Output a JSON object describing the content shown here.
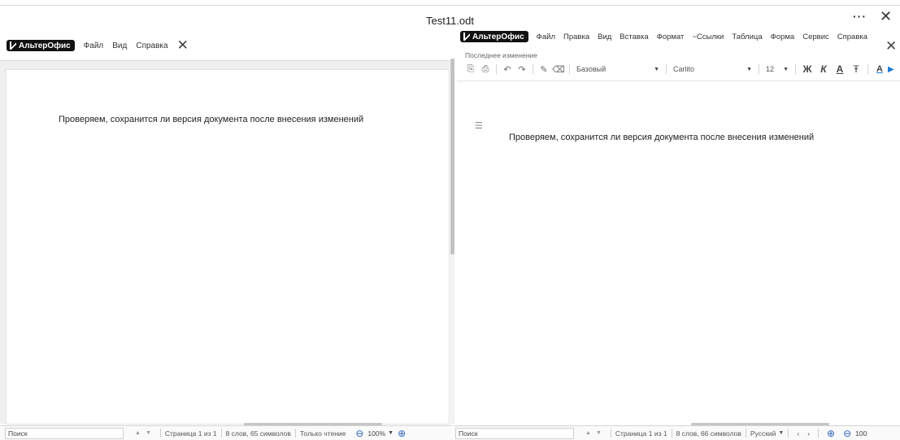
{
  "window": {
    "title": "Test11.odt",
    "more_label": "···",
    "close_label": "✕"
  },
  "left_pane": {
    "logo": "АльтерОфис",
    "menu": [
      "Файл",
      "Вид",
      "Справка"
    ],
    "close_label": "✕",
    "document_text": "Проверяем, сохранится ли версия документа после внесения изменений",
    "status": {
      "search_placeholder": "Поиск",
      "page": "Страница 1 из 1",
      "words": "8 слов, 65 символов",
      "mode": "Только чтение",
      "zoom": "100%"
    }
  },
  "right_pane": {
    "logo": "АльтерОфис",
    "menu": [
      "Файл",
      "Правка",
      "Вид",
      "Вставка",
      "Формат",
      "~Ссылки",
      "Таблица",
      "Форма",
      "Сервис",
      "Справка"
    ],
    "close_label": "✕",
    "last_change": "Последнее изменение",
    "toolbar": {
      "style": "Базовый",
      "font": "Carlito",
      "size": "12",
      "bold": "Ж",
      "italic": "К",
      "underline": "А",
      "strike": "Ŧ",
      "font_color": "А"
    },
    "document_text": "Проверяем, сохранится ли версия документа после внесения изменений",
    "status": {
      "search_placeholder": "Поиск",
      "page": "Страница 1 из 1",
      "words": "8 слов, 66 символов",
      "language": "Русский",
      "zoom": "100"
    }
  },
  "colors": {
    "accent": "#2b5fb8",
    "logo_bg": "#111111",
    "font_color_marker": "#1f7bd8"
  }
}
